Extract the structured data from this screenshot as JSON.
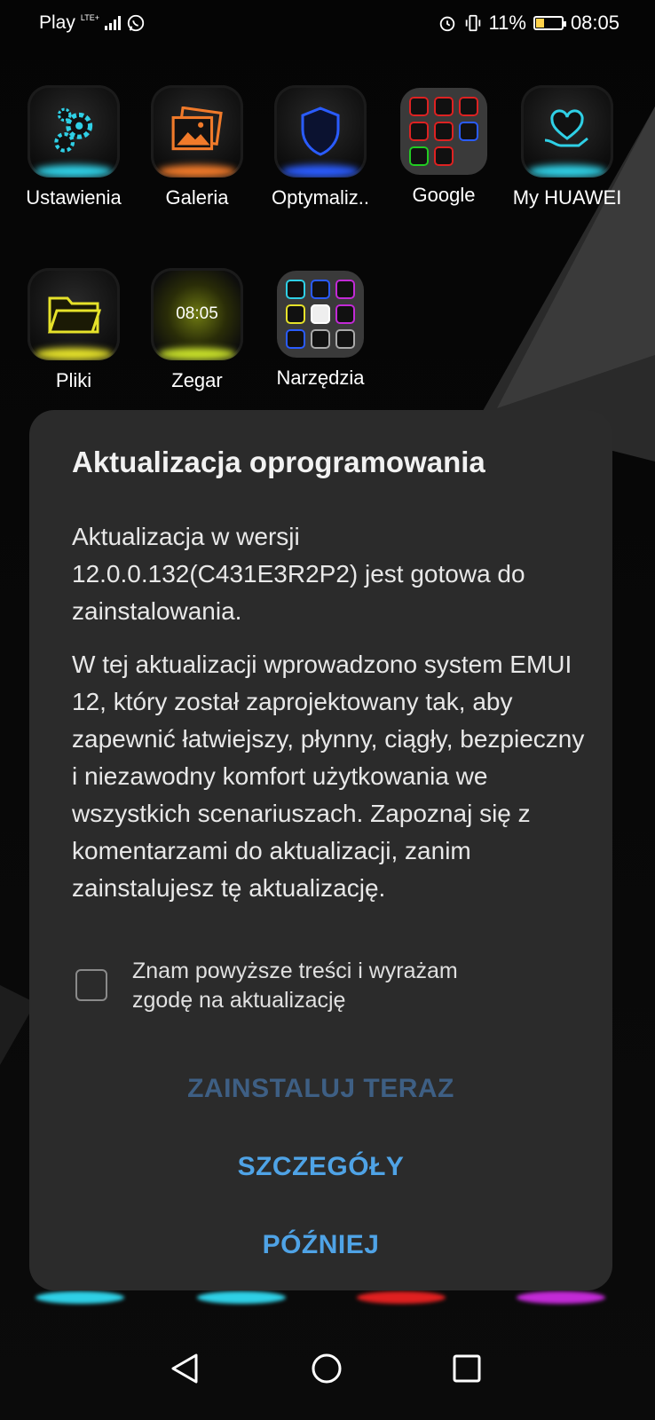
{
  "status_bar": {
    "carrier": "Play",
    "network": "LTE+",
    "battery": "11%",
    "time": "08:05",
    "icons": [
      "whatsapp-icon",
      "alarm-icon",
      "vibrate-icon",
      "battery-icon"
    ]
  },
  "home_apps": [
    {
      "label": "Ustawienia",
      "icon": "settings-gears-icon",
      "glow": "#2fd0e6"
    },
    {
      "label": "Galeria",
      "icon": "gallery-photos-icon",
      "glow": "#f07a2a"
    },
    {
      "label": "Optymaliz..",
      "icon": "shield-icon",
      "glow": "#2a5cff"
    },
    {
      "label": "Google",
      "icon": "folder-icon",
      "glow": ""
    },
    {
      "label": "My HUAWEI",
      "icon": "heart-hand-icon",
      "glow": "#2fd0e6"
    },
    {
      "label": "Pliki",
      "icon": "folder-files-icon",
      "glow": "#e6e22a"
    },
    {
      "label": "Zegar",
      "icon": "clock-icon",
      "glow": "#c8e02a",
      "clock_text": "08:05"
    },
    {
      "label": "Narzędzia",
      "icon": "folder-icon",
      "glow": ""
    }
  ],
  "dialog": {
    "title": "Aktualizacja oprogramowania",
    "body_1": "Aktualizacja w wersji 12.0.0.132(C431E3R2P2) jest gotowa do zainstalowania.",
    "body_2": "W tej aktualizacji wprowadzono system EMUI 12, który został zaprojektowany tak, aby zapewnić łatwiejszy, płynny, ciągły, bezpieczny i niezawodny komfort użytkowania we wszystkich scenariuszach. Zapoznaj się z komentarzami do aktualizacji, zanim zainstalujesz tę aktualizację.",
    "consent_label": "Znam powyższe treści i wyrażam zgodę na aktualizację",
    "consent_checked": false,
    "install_button": "ZAINSTALUJ TERAZ",
    "install_enabled": false,
    "details_button": "SZCZEGÓŁY",
    "later_button": "PÓŹNIEJ"
  },
  "colors": {
    "dialog_bg": "#2b2b2b",
    "accent": "#4fa3e6",
    "disabled_accent": "#3e5f84"
  }
}
